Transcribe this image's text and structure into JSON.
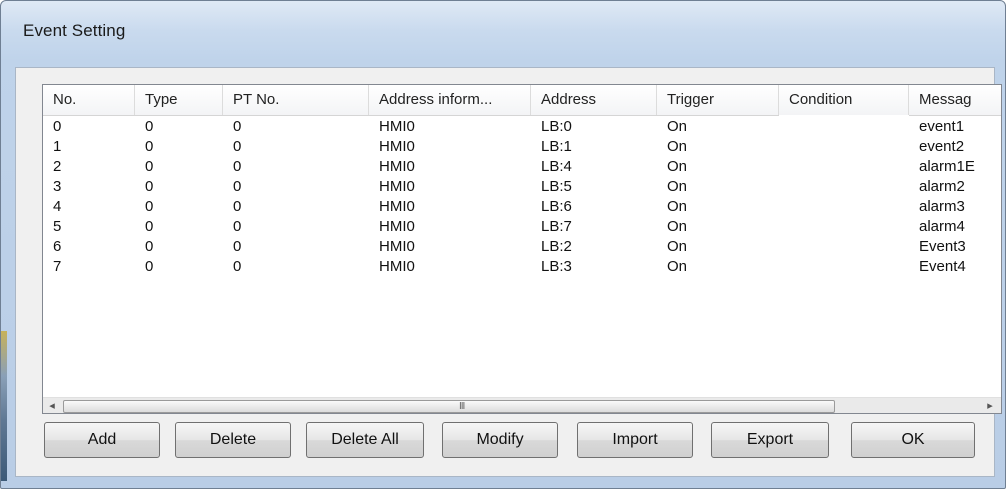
{
  "window": {
    "title": "Event Setting"
  },
  "columns": [
    "No.",
    "Type",
    "PT No.",
    "Address inform...",
    "Address",
    "Trigger",
    "Condition",
    "Messag"
  ],
  "rows": [
    [
      "0",
      "0",
      "0",
      "HMI0",
      "LB:0",
      "On",
      "",
      "event1"
    ],
    [
      "1",
      "0",
      "0",
      "HMI0",
      "LB:1",
      "On",
      "",
      "event2"
    ],
    [
      "2",
      "0",
      "0",
      "HMI0",
      "LB:4",
      "On",
      "",
      "alarm1E"
    ],
    [
      "3",
      "0",
      "0",
      "HMI0",
      "LB:5",
      "On",
      "",
      "alarm2"
    ],
    [
      "4",
      "0",
      "0",
      "HMI0",
      "LB:6",
      "On",
      "",
      "alarm3"
    ],
    [
      "5",
      "0",
      "0",
      "HMI0",
      "LB:7",
      "On",
      "",
      "alarm4"
    ],
    [
      "6",
      "0",
      "0",
      "HMI0",
      "LB:2",
      "On",
      "",
      "Event3"
    ],
    [
      "7",
      "0",
      "0",
      "HMI0",
      "LB:3",
      "On",
      "",
      "Event4"
    ]
  ],
  "scrollbar": {
    "left_arrow": "◂",
    "right_arrow": "▸",
    "grip": "III"
  },
  "buttons": {
    "add": "Add",
    "delete": "Delete",
    "delete_all": "Delete All",
    "modify": "Modify",
    "import": "Import",
    "export": "Export",
    "ok": "OK"
  }
}
